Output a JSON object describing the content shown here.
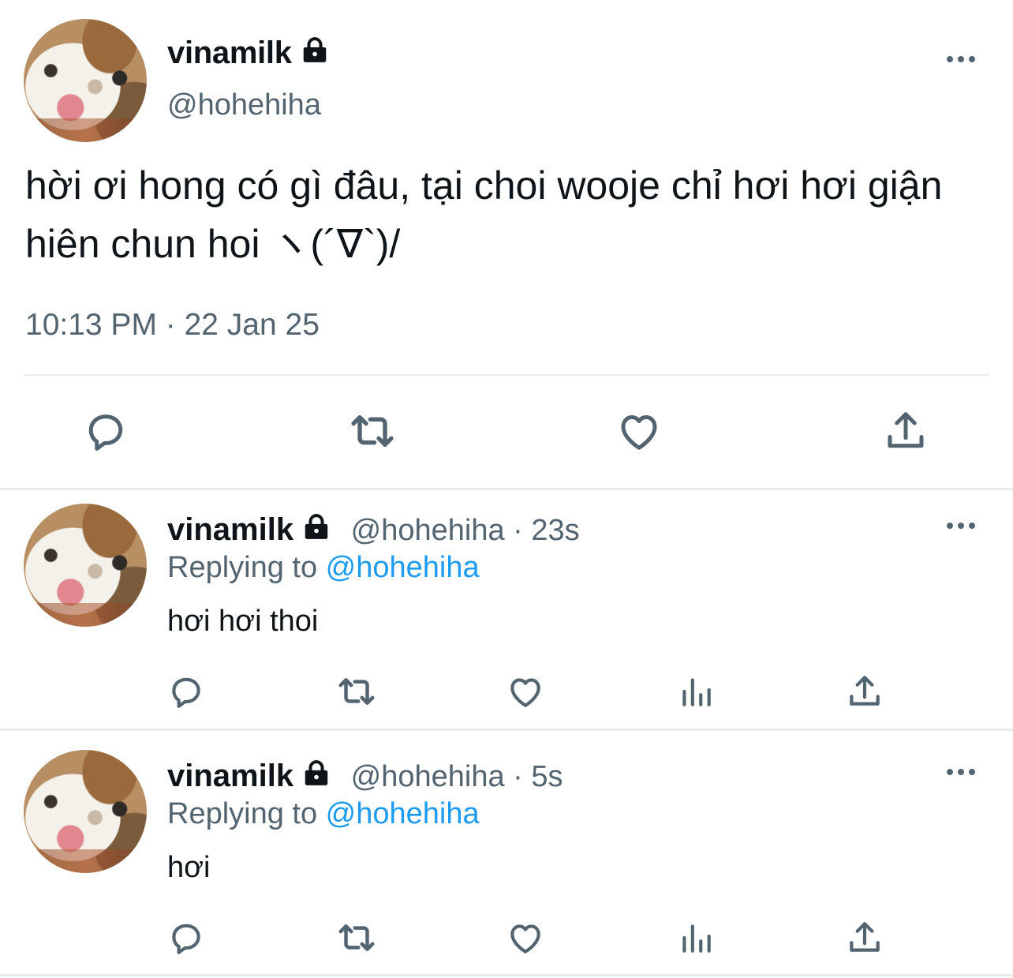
{
  "main_tweet": {
    "display_name": "vinamilk",
    "handle": "@hohehiha",
    "text": "hời ơi hong có gì đâu, tại choi wooje chỉ hơi hơi giận hiên chun hoi ヽ(´∇`)/",
    "timestamp": "10:13 PM · 22 Jan 25",
    "actions": [
      "reply-icon",
      "retweet-icon",
      "like-icon",
      "share-icon"
    ]
  },
  "replies": [
    {
      "display_name": "vinamilk",
      "handle": "@hohehiha",
      "separator": " · ",
      "time": "23s",
      "replying_prefix": "Replying to ",
      "replying_to": "@hohehiha",
      "text": "hơi hơi thoi",
      "actions": [
        "reply-icon",
        "retweet-icon",
        "like-icon",
        "analytics-icon",
        "share-icon"
      ]
    },
    {
      "display_name": "vinamilk",
      "handle": "@hohehiha",
      "separator": " · ",
      "time": "5s",
      "replying_prefix": "Replying to ",
      "replying_to": "@hohehiha",
      "text": "hơi",
      "actions": [
        "reply-icon",
        "retweet-icon",
        "like-icon",
        "analytics-icon",
        "share-icon"
      ]
    }
  ],
  "colors": {
    "text_primary": "#0f1419",
    "text_secondary": "#536471",
    "link": "#1d9bf0",
    "divider": "#e6ecf0"
  }
}
